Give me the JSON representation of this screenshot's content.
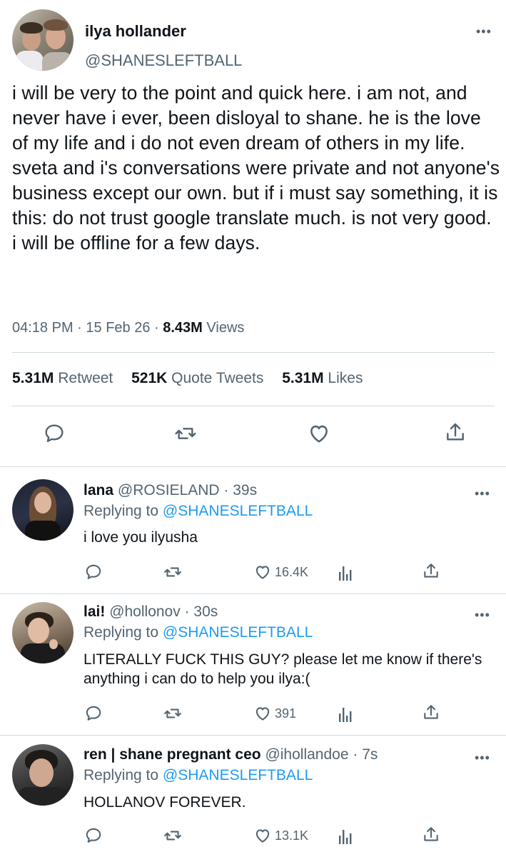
{
  "tweet": {
    "author_name": "ilya hollander",
    "author_handle": "@SHANESLEFTBALL",
    "more_icon": "•••",
    "text": "i will be very to the point and quick here. i am not, and never have i ever, been disloyal to shane. he is the love of my life and i do not even dream of others in my life.\nsveta and i's conversations were private and not anyone's business except our own. but if i must say something, it is this: do not trust google translate much. is not very good.\ni will be offline for a few days.",
    "time": "04:18 PM",
    "date": "15 Feb 26",
    "views_count": "8.43M",
    "views_label": "Views",
    "retweets_count": "5.31M",
    "retweets_label": "Retweet",
    "quotes_count": "521K",
    "quotes_label": "Quote Tweets",
    "likes_count": "5.31M",
    "likes_label": "Likes",
    "actions": [
      "reply-icon",
      "retweet-icon",
      "like-icon",
      "share-icon"
    ]
  },
  "replies": [
    {
      "name": "lana",
      "handle": "@ROSIELAND",
      "time": "39s",
      "replying_label": "Replying to",
      "replying_handle": "@SHANESLEFTBALL",
      "text": "i love you ilyusha",
      "likes": "16.4K",
      "more_icon": "•••"
    },
    {
      "name": "lai!",
      "handle": "@hollonov",
      "time": "30s",
      "replying_label": "Replying to",
      "replying_handle": "@SHANESLEFTBALL",
      "text": "LITERALLY FUCK THIS GUY? please let me know if there's anything i can do to help you ilya:(",
      "likes": "391",
      "more_icon": "•••"
    },
    {
      "name": "ren | shane pregnant ceo",
      "handle": "@ihollandoe",
      "time": "7s",
      "replying_label": "Replying to",
      "replying_handle": "@SHANESLEFTBALL",
      "text": "HOLLANOV FOREVER.",
      "likes": "13.1K",
      "more_icon": "•••"
    }
  ],
  "colors": {
    "link": "#1d9bf0",
    "secondary_text": "#536471",
    "primary_text": "#0f1419",
    "divider": "#cfd9de"
  }
}
